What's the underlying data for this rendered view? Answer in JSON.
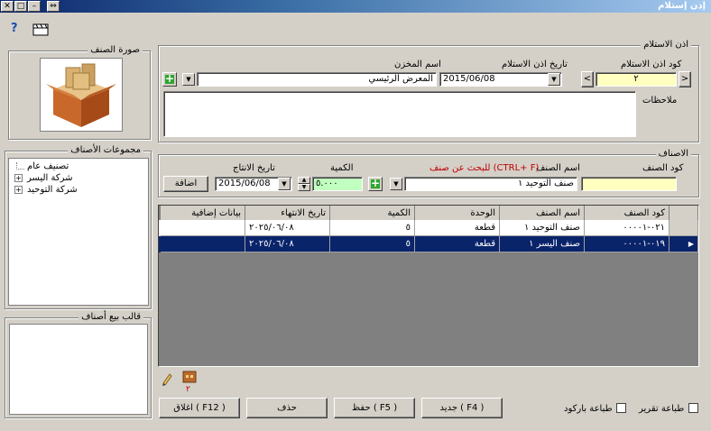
{
  "window": {
    "title": "إذن إستلام",
    "close_label": "✕",
    "min_label": "–",
    "max_label": "□",
    "restore_label": "⇔"
  },
  "toolbar": {
    "help_label": "?"
  },
  "receipt_group": {
    "legend": "اذن الاستلام",
    "code_label": "كود اذن الاستلام",
    "code_value": "٢",
    "prev_label": "<",
    "next_label": ">",
    "date_label": "تاريخ اذن الاستلام",
    "date_value": "2015/06/08",
    "store_label": "اسم المخزن",
    "store_value": "المعرض الرئيسي",
    "notes_label": "ملاحظات"
  },
  "items_group": {
    "legend": "الاصناف",
    "item_code_label": "كود الصنف",
    "item_name_label": "اسم الصنف",
    "search_hint": "للبحث عن صنف (CTRL+ F)",
    "item_name_value": "صنف التوحيد ١",
    "qty_label": "الكمية",
    "qty_value": "٥.٠٠٠",
    "prod_date_label": "تاريخ الانتاج",
    "prod_date_value": "2015/06/08",
    "add_button": "اضافة"
  },
  "table": {
    "columns": [
      "كود الصنف",
      "اسم الصنف",
      "الوحدة",
      "الكمية",
      "تاريخ الانتهاء",
      "بيانات إضافية"
    ],
    "rows": [
      {
        "code": "٠٢١-٠٠٠٠١",
        "name": "صنف التوحيد ١",
        "unit": "قطعة",
        "qty": "٥",
        "expiry": "٢٠٢٥/٠٦/٠٨",
        "extra": ""
      },
      {
        "code": "٠١٩-٠٠٠٠١",
        "name": "صنف اليسر ١",
        "unit": "قطعة",
        "qty": "٥",
        "expiry": "٢٠٢٥/٠٦/٠٨",
        "extra": ""
      }
    ]
  },
  "side": {
    "image_legend": "صورة الصنف",
    "groups_legend": "مجموعات الأصناف",
    "tree": [
      "تصنيف عام",
      "شركة اليسر",
      "شركة التوحيد"
    ],
    "template_legend": "قالب بيع أصناف"
  },
  "badge_count": "٢",
  "bottom": {
    "new_button": "جديد ( F4 )",
    "save_button": "حفظ ( F5 )",
    "delete_button": "حذف",
    "close_button": "اغلاق ( F12 )",
    "print_report": "طباعة تقرير",
    "print_barcode": "طباعة باركود"
  },
  "colors": {
    "selected_row": "#0a246a",
    "code_highlight": "#ffffc0",
    "qty_highlight": "#c0ffc0",
    "search_hint": "#c00000"
  }
}
